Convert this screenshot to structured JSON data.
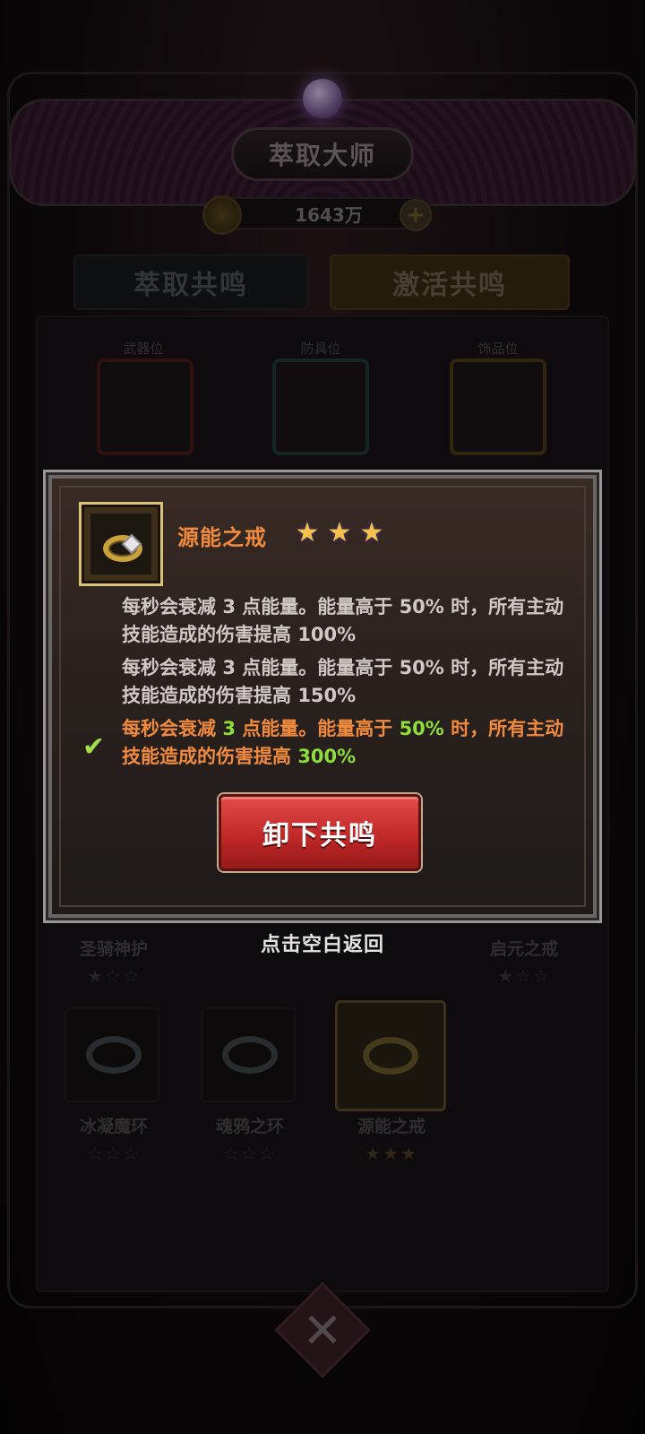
{
  "header": {
    "title": "萃取大师",
    "currency": "1643万",
    "plus_symbol": "+"
  },
  "tabs": [
    {
      "label": "萃取共鸣"
    },
    {
      "label": "激活共鸣"
    }
  ],
  "slots": [
    {
      "label": "武器位"
    },
    {
      "label": "防具位"
    },
    {
      "label": "饰品位"
    }
  ],
  "grid": [
    {
      "name": "圣骑神护",
      "stars": 1
    },
    {
      "name": "启元之戒",
      "stars": 1
    },
    {
      "name": "冰凝魔环",
      "stars": 0
    },
    {
      "name": "魂鸦之环",
      "stars": 0
    },
    {
      "name": "源能之戒",
      "stars": 3
    }
  ],
  "modal": {
    "item_name": "源能之戒",
    "stars": 3,
    "tiers": [
      {
        "pre": "每秒会衰减 ",
        "n1": "3",
        "mid": " 点能量。能量高于 ",
        "n2": "50%",
        "post": " 时，所有主动技能造成的伤害提高 ",
        "n3": "100%"
      },
      {
        "pre": "每秒会衰减 ",
        "n1": "3",
        "mid": " 点能量。能量高于 ",
        "n2": "50%",
        "post": " 时，所有主动技能造成的伤害提高 ",
        "n3": "150%"
      },
      {
        "pre": "每秒会衰减 ",
        "n1": "3",
        "mid": " 点能量。能量高于 ",
        "n2": "50%",
        "post": " 时，所有主动技能造成的伤害提高 ",
        "n3": "300%"
      }
    ],
    "active_tier_check": "✔",
    "unequip_label": "卸下共鸣"
  },
  "return_hint": "点击空白返回",
  "colors": {
    "accent_orange": "#f08a3e",
    "highlight_green": "#8ede3a",
    "button_red": "#c12828",
    "star_gold": "#f2c24a"
  }
}
